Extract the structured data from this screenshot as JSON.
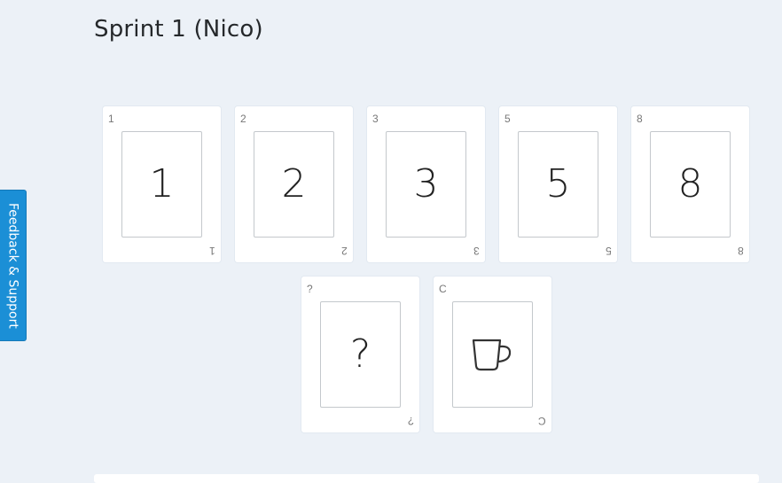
{
  "page": {
    "title": "Sprint 1 (Nico)"
  },
  "feedback": {
    "label": "Feedback & Support"
  },
  "cards": [
    {
      "corner": "1",
      "value": "1"
    },
    {
      "corner": "2",
      "value": "2"
    },
    {
      "corner": "3",
      "value": "3"
    },
    {
      "corner": "5",
      "value": "5"
    },
    {
      "corner": "8",
      "value": "8"
    },
    {
      "corner": "?",
      "value": "?"
    },
    {
      "corner": "C",
      "value": "",
      "icon": "coffee-cup-icon"
    }
  ]
}
